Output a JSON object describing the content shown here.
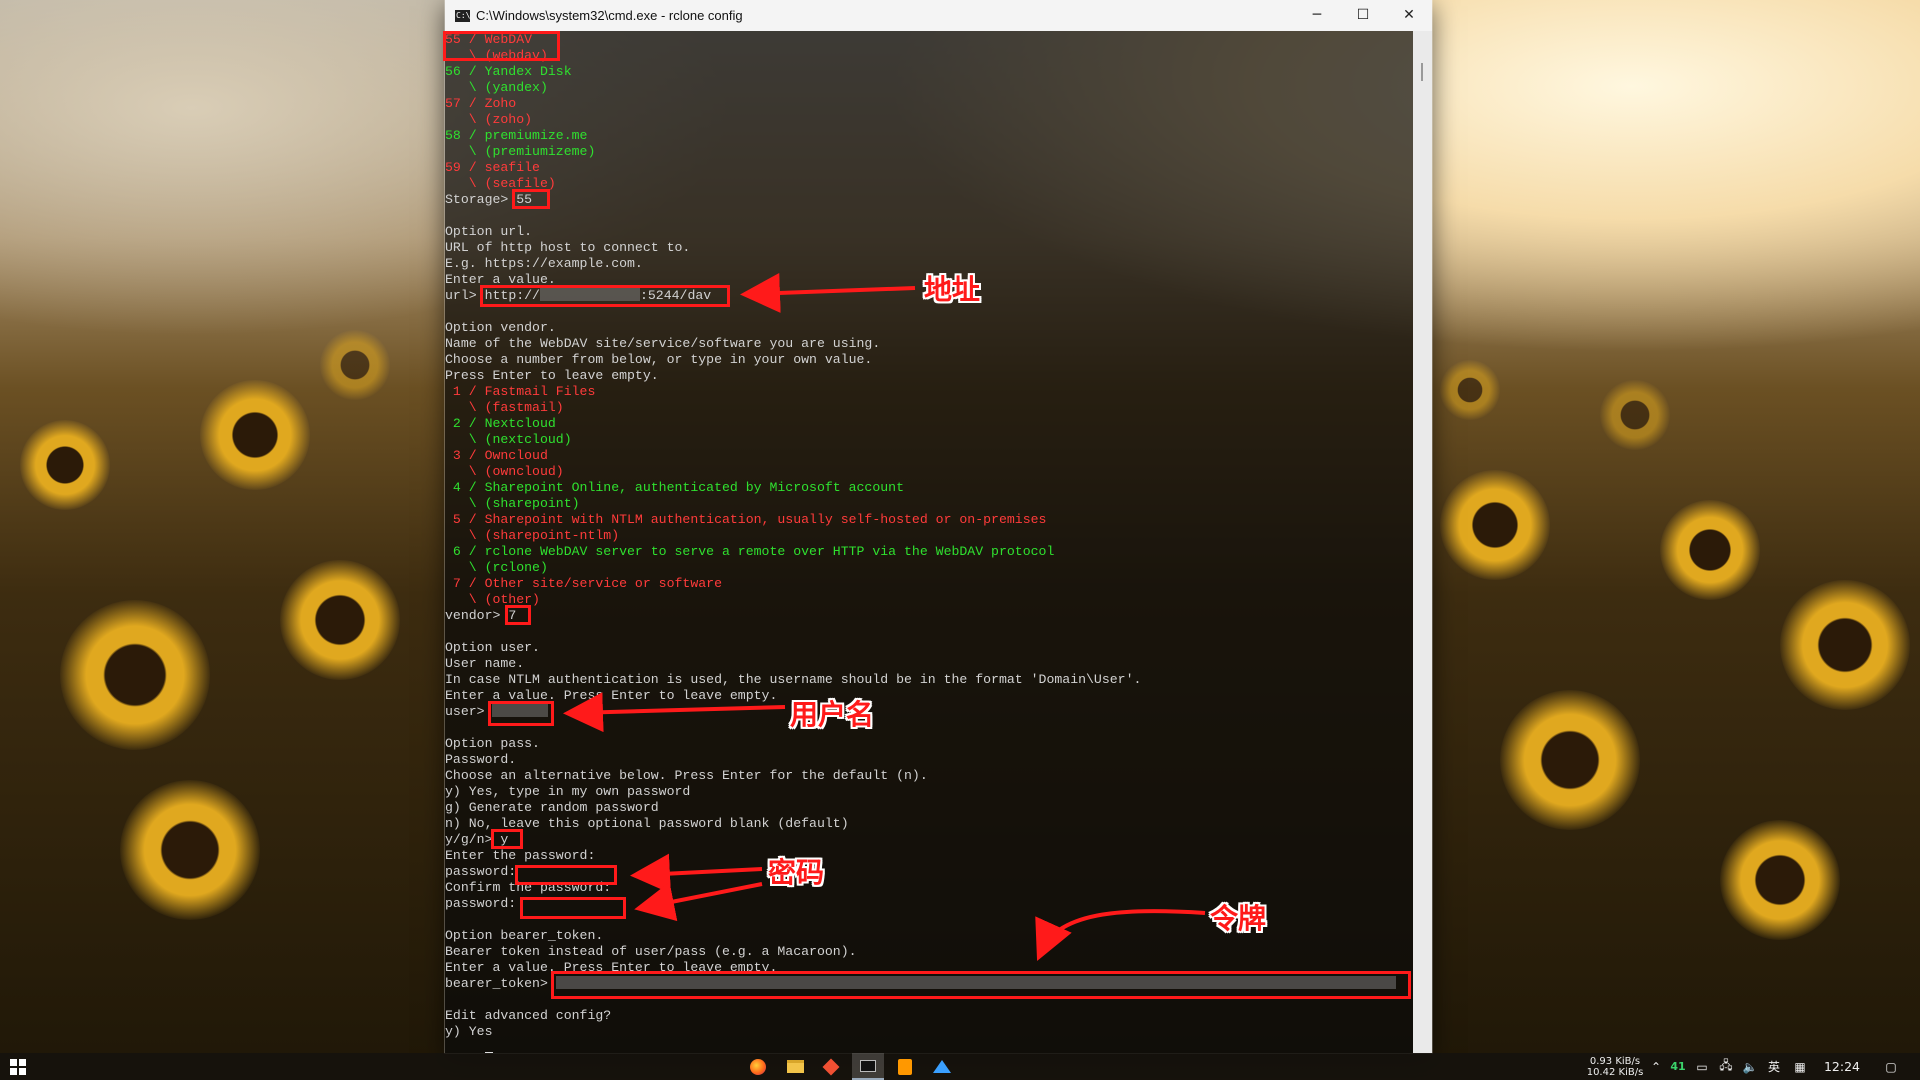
{
  "window": {
    "title": "C:\\Windows\\system32\\cmd.exe - rclone  config",
    "icon": "cmd-icon",
    "minimize": "─",
    "maximize": "☐",
    "close": "✕"
  },
  "terminal": {
    "l01": "55 / WebDAV",
    "l02": "   \\ (webdav)",
    "l03": "56 / Yandex Disk",
    "l04": "   \\ (yandex)",
    "l05": "57 / Zoho",
    "l06": "   \\ (zoho)",
    "l07": "58 / premiumize.me",
    "l08": "   \\ (premiumizeme)",
    "l09": "59 / seafile",
    "l10": "   \\ (seafile)",
    "storage_prompt": "Storage> ",
    "storage_value": "55",
    "l13": "Option url.",
    "l14": "URL of http host to connect to.",
    "l15": "E.g. https://example.com.",
    "l16": "Enter a value.",
    "url_prompt": "url> ",
    "url_prefix": "http://",
    "url_suffix": ":5244/dav",
    "l19": "Option vendor.",
    "l20": "Name of the WebDAV site/service/software you are using.",
    "l21": "Choose a number from below, or type in your own value.",
    "l22": "Press Enter to leave empty.",
    "v1": " 1 / Fastmail Files",
    "v1b": "   \\ (fastmail)",
    "v2": " 2 / Nextcloud",
    "v2b": "   \\ (nextcloud)",
    "v3": " 3 / Owncloud",
    "v3b": "   \\ (owncloud)",
    "v4": " 4 / Sharepoint Online, authenticated by Microsoft account",
    "v4b": "   \\ (sharepoint)",
    "v5": " 5 / Sharepoint with NTLM authentication, usually self-hosted or on-premises",
    "v5b": "   \\ (sharepoint-ntlm)",
    "v6": " 6 / rclone WebDAV server to serve a remote over HTTP via the WebDAV protocol",
    "v6b": "   \\ (rclone)",
    "v7": " 7 / Other site/service or software",
    "v7b": "   \\ (other)",
    "vendor_prompt": "vendor> ",
    "vendor_value": "7",
    "l40": "Option user.",
    "l41": "User name.",
    "l42": "In case NTLM authentication is used, the username should be in the format 'Domain\\User'.",
    "l43": "Enter a value. Press Enter to leave empty.",
    "user_prompt": "user> ",
    "l46": "Option pass.",
    "l47": "Password.",
    "l48": "Choose an alternative below. Press Enter for the default (n).",
    "l49": "y) Yes, type in my own password",
    "l50": "g) Generate random password",
    "l51": "n) No, leave this optional password blank (default)",
    "yn_prompt": "y/g/n> ",
    "yn_value": "y",
    "l53": "Enter the password:",
    "pw_prompt": "password:",
    "l55": "Confirm the password:",
    "pw2_prompt": "password:",
    "l58": "Option bearer_token.",
    "l59": "Bearer token instead of user/pass (e.g. a Macaroon).",
    "l60": "Enter a value. Press Enter to leave empty.",
    "token_prompt": "bearer_token> ",
    "l63": "Edit advanced config?",
    "l64": "y) Yes"
  },
  "annotations": {
    "url_label": "地址",
    "user_label": "用户名",
    "password_label": "密码",
    "token_label": "令牌",
    "color": "#ff1a1a"
  },
  "taskbar": {
    "start_icon": "windows-logo-icon",
    "apps": [
      "firefox-icon",
      "file-explorer-icon",
      "git-icon",
      "cmd-icon",
      "sublime-text-icon",
      "app-icon"
    ],
    "net_up": "0.93 KiB/s",
    "net_down": "10.42 KiB/s",
    "tray_badge": "41",
    "ime": "英",
    "clock": "12:24"
  },
  "colors": {
    "green": "#2fe02f",
    "red": "#ff3b3b",
    "text": "#d2d2d2"
  }
}
